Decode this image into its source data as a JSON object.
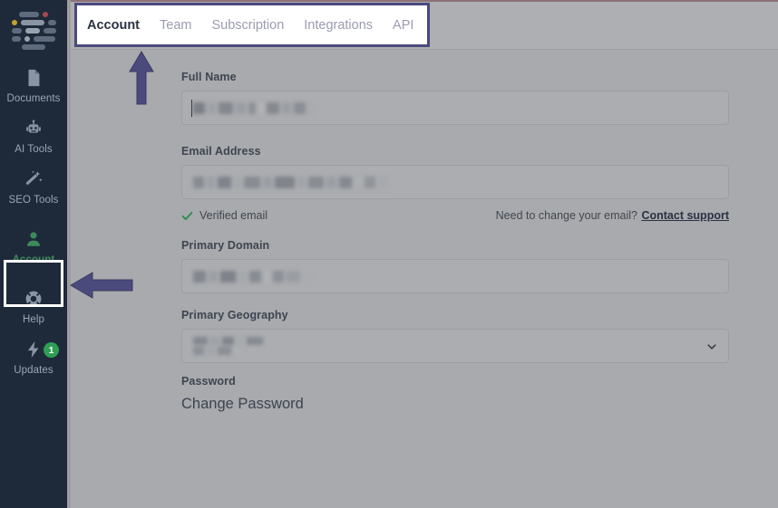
{
  "colors": {
    "sidebar_bg": "#1e2a3a",
    "page_bg": "#a8aaad",
    "accent_green": "#3d8b5a",
    "badge_green": "#2f9e54",
    "annotation_purple": "#4a4a7d",
    "highlight_white": "#ffffff",
    "tab_active_text": "#2a3142",
    "tab_inactive_text": "#9a9cb0"
  },
  "sidebar": {
    "logo": {
      "name": "app-logo",
      "redacted": true
    },
    "items": [
      {
        "label": "Documents",
        "icon": "document-icon",
        "active": false,
        "badge": null
      },
      {
        "label": "AI Tools",
        "icon": "robot-icon",
        "active": false,
        "badge": null
      },
      {
        "label": "SEO Tools",
        "icon": "magic-wand-icon",
        "active": false,
        "badge": null
      },
      {
        "label": "Account",
        "icon": "person-icon",
        "active": true,
        "badge": null
      },
      {
        "label": "Help",
        "icon": "lifebuoy-icon",
        "active": false,
        "badge": null
      },
      {
        "label": "Updates",
        "icon": "lightning-bolt-icon",
        "active": false,
        "badge": "1"
      }
    ]
  },
  "tabs": [
    {
      "label": "Account",
      "active": true
    },
    {
      "label": "Team",
      "active": false
    },
    {
      "label": "Subscription",
      "active": false
    },
    {
      "label": "Integrations",
      "active": false
    },
    {
      "label": "API",
      "active": false
    }
  ],
  "form": {
    "full_name": {
      "label": "Full Name",
      "value": "",
      "redacted": true,
      "has_caret": true
    },
    "email": {
      "label": "Email Address",
      "value": "",
      "redacted": true,
      "verified_text": "Verified email",
      "need_change_text": "Need to change your email?",
      "support_link_text": "Contact support"
    },
    "primary_domain": {
      "label": "Primary Domain",
      "value": "",
      "redacted": true
    },
    "primary_geography": {
      "label": "Primary Geography",
      "value": "",
      "redacted": true,
      "type": "select"
    },
    "password": {
      "label": "Password",
      "action_text": "Change Password"
    }
  },
  "annotations": [
    {
      "name": "arrow-to-tabbar",
      "direction": "up",
      "target": "tab-bar"
    },
    {
      "name": "arrow-to-account-nav",
      "direction": "left",
      "target": "sidebar-item-account"
    },
    {
      "name": "highlight-box-tabbar",
      "target": "tab-bar"
    },
    {
      "name": "highlight-box-account-nav",
      "target": "sidebar-item-account"
    }
  ]
}
